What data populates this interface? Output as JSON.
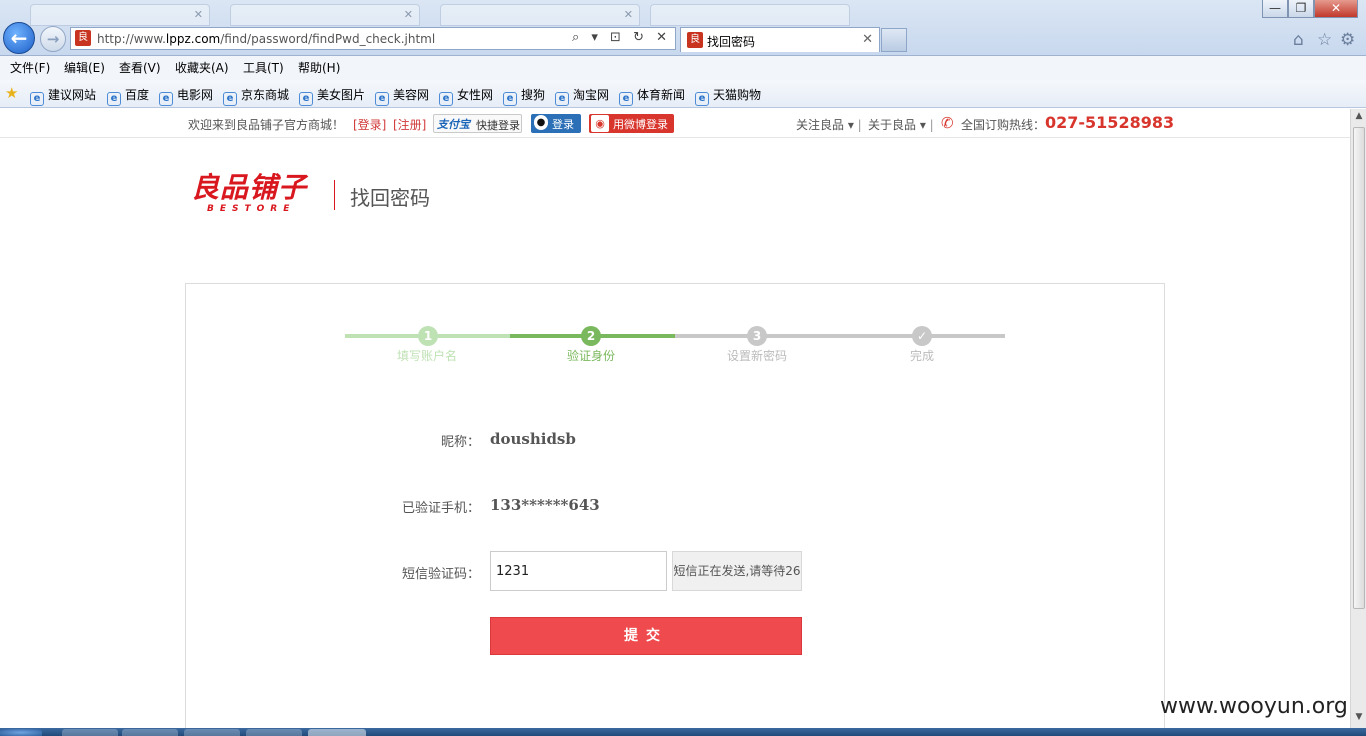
{
  "browser": {
    "background_tabs": [
      "",
      "",
      "",
      ""
    ],
    "window_controls": {
      "minimize": "—",
      "restore": "❐",
      "close": "✕"
    },
    "address": {
      "url_prefix": "http://www.",
      "url_domain": "lppz.com",
      "url_path": "/find/password/findPwd_check.jhtml",
      "tools": "⌕ ▾ ⊡ ↻ ✕"
    },
    "active_tab": {
      "title": "找回密码",
      "close": "✕"
    },
    "tool_icons": {
      "home": "⌂",
      "favorites": "☆",
      "settings": "⚙"
    },
    "menu": [
      "文件(F)",
      "编辑(E)",
      "查看(V)",
      "收藏夹(A)",
      "工具(T)",
      "帮助(H)"
    ],
    "favorites": [
      "建议网站",
      "百度",
      "电影网",
      "京东商城",
      "美女图片",
      "美容网",
      "女性网",
      "搜狗",
      "淘宝网",
      "体育新闻",
      "天猫购物"
    ]
  },
  "topbar": {
    "welcome": "欢迎来到良品铺子官方商城！",
    "login": "[登录]",
    "register": "[注册]",
    "alipay_logo": "支付宝",
    "alipay_label": "快捷登录",
    "qq_label": "登录",
    "weibo_label": "用微博登录",
    "follow": "关注良品",
    "about": "关于良品",
    "hotline_label": "全国订购热线：",
    "hotline_number": "027-51528983"
  },
  "header": {
    "logo_text": "良品铺子",
    "logo_sub": "BESTORE",
    "page_title": "找回密码"
  },
  "steps": [
    {
      "num": "1",
      "label": "填写账户名",
      "state": "done"
    },
    {
      "num": "2",
      "label": "验证身份",
      "state": "current"
    },
    {
      "num": "3",
      "label": "设置新密码",
      "state": "todo"
    },
    {
      "num": "✓",
      "label": "完成",
      "state": "todo"
    }
  ],
  "colors": {
    "step_done": "#bfe2b4",
    "step_current": "#7ab85d",
    "step_todo": "#c8c8c8",
    "accent_red": "#ef4a4d"
  },
  "form": {
    "nickname_label": "昵称：",
    "nickname_value": "doushidsb",
    "phone_label": "已验证手机：",
    "phone_value": "133******643",
    "sms_label": "短信验证码：",
    "sms_value": "1231",
    "sms_button": "短信正在发送,请等待26",
    "submit": "提交"
  },
  "watermark": "www.wooyun.org"
}
